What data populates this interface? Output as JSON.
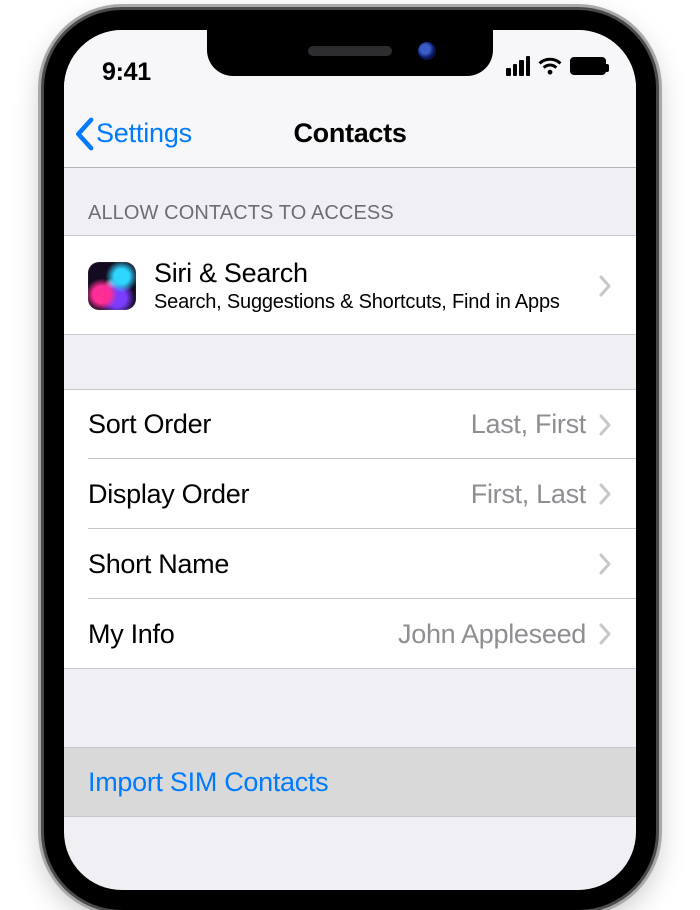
{
  "status": {
    "time": "9:41"
  },
  "nav": {
    "back_label": "Settings",
    "title": "Contacts"
  },
  "section_access": {
    "header": "ALLOW CONTACTS TO ACCESS",
    "siri": {
      "title": "Siri & Search",
      "subtitle": "Search, Suggestions & Shortcuts, Find in Apps"
    }
  },
  "options": {
    "sort_order": {
      "label": "Sort Order",
      "value": "Last, First"
    },
    "display_order": {
      "label": "Display Order",
      "value": "First, Last"
    },
    "short_name": {
      "label": "Short Name",
      "value": ""
    },
    "my_info": {
      "label": "My Info",
      "value": "John Appleseed"
    }
  },
  "import": {
    "label": "Import SIM Contacts"
  }
}
